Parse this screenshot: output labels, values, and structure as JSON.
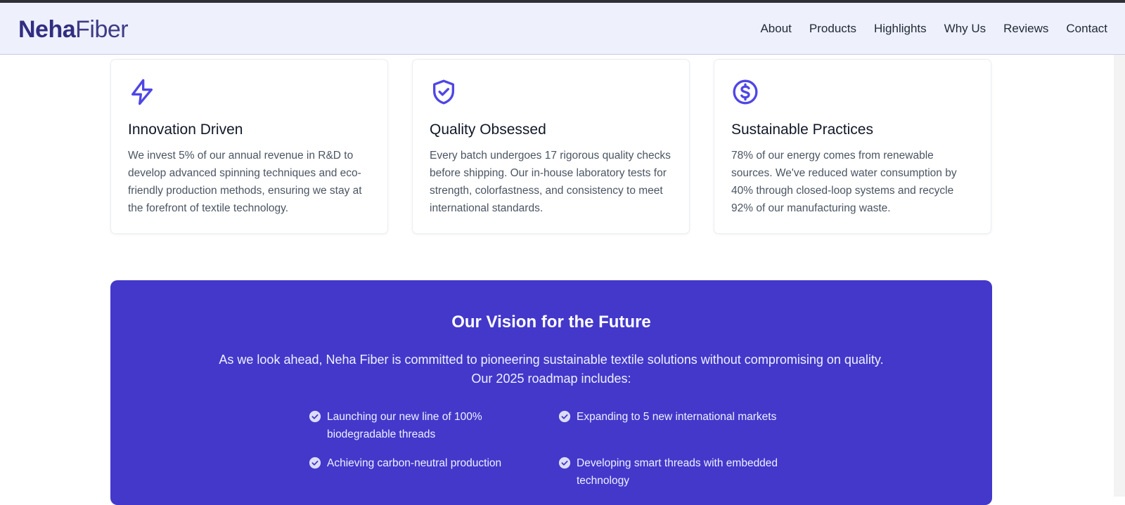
{
  "brand": {
    "bold": "Neha",
    "light": "Fiber"
  },
  "nav": [
    "About",
    "Products",
    "Highlights",
    "Why Us",
    "Reviews",
    "Contact"
  ],
  "features": [
    {
      "icon": "lightning-bolt-icon",
      "title": "Innovation Driven",
      "text": "We invest 5% of our annual revenue in R&D to develop advanced spinning techniques and eco-friendly production methods, ensuring we stay at the forefront of textile technology."
    },
    {
      "icon": "shield-check-icon",
      "title": "Quality Obsessed",
      "text": "Every batch undergoes 17 rigorous quality checks before shipping. Our in-house laboratory tests for strength, colorfastness, and consistency to meet international standards."
    },
    {
      "icon": "dollar-circle-icon",
      "title": "Sustainable Practices",
      "text": "78% of our energy comes from renewable sources. We've reduced water consumption by 40% through closed-loop systems and recycle 92% of our manufacturing waste."
    }
  ],
  "vision": {
    "title": "Our Vision for the Future",
    "body": "As we look ahead, Neha Fiber is committed to pioneering sustainable textile solutions without compromising on quality. Our 2025 roadmap includes:",
    "items": [
      "Launching our new line of 100% biodegradable threads",
      "Expanding to 5 new international markets",
      "Achieving carbon-neutral production",
      "Developing smart threads with embedded technology"
    ]
  },
  "colors": {
    "accent": "#4338ca",
    "nav_bg": "#eef0fc",
    "brand": "#312e81"
  }
}
